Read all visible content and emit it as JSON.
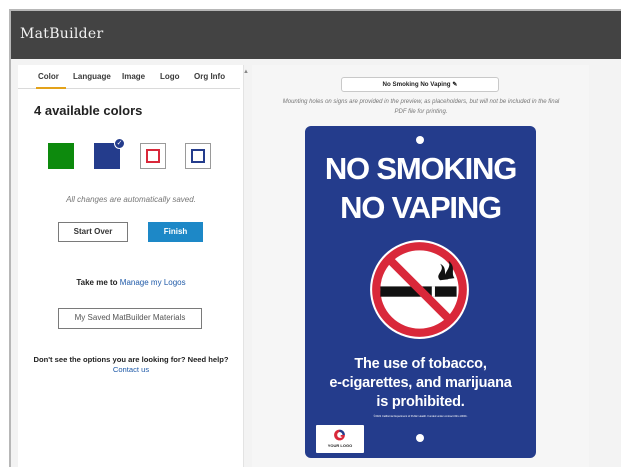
{
  "app": {
    "title": "MatBuilder"
  },
  "tabs": [
    "Color",
    "Language",
    "Image",
    "Logo",
    "Org Info"
  ],
  "colors": {
    "heading": "4 available colors",
    "swatches": [
      {
        "name": "green",
        "hex": "#0d8a0d",
        "style": "filled"
      },
      {
        "name": "navy",
        "hex": "#243c8c",
        "style": "filled",
        "selected": true
      },
      {
        "name": "red",
        "hex": "#d9283a",
        "style": "outline"
      },
      {
        "name": "blue",
        "hex": "#243c8c",
        "style": "outline"
      }
    ],
    "autosave_note": "All changes are automatically saved."
  },
  "actions": {
    "start_over": "Start Over",
    "finish": "Finish"
  },
  "manage": {
    "prefix": "Take me to",
    "link": "Manage my Logos"
  },
  "saved_materials": "My Saved MatBuilder Materials",
  "help": {
    "question": "Don't see the options you are looking for? Need help?",
    "link": "Contact us"
  },
  "preview": {
    "title": "No Smoking No Vaping",
    "note": "Mounting holes on signs are provided in the preview, as placeholders, but will not be included in the final PDF file for printing."
  },
  "sign": {
    "bg": "#243c8c",
    "headline": [
      "NO SMOKING",
      "NO VAPING"
    ],
    "body": [
      "The use of tobacco,",
      "e-cigarettes, and marijuana",
      "is prohibited."
    ],
    "fine_print": "©2021 California Department of Public Health. Funded under contract #21-10001.",
    "logo_text": "YOUR LOGO"
  }
}
